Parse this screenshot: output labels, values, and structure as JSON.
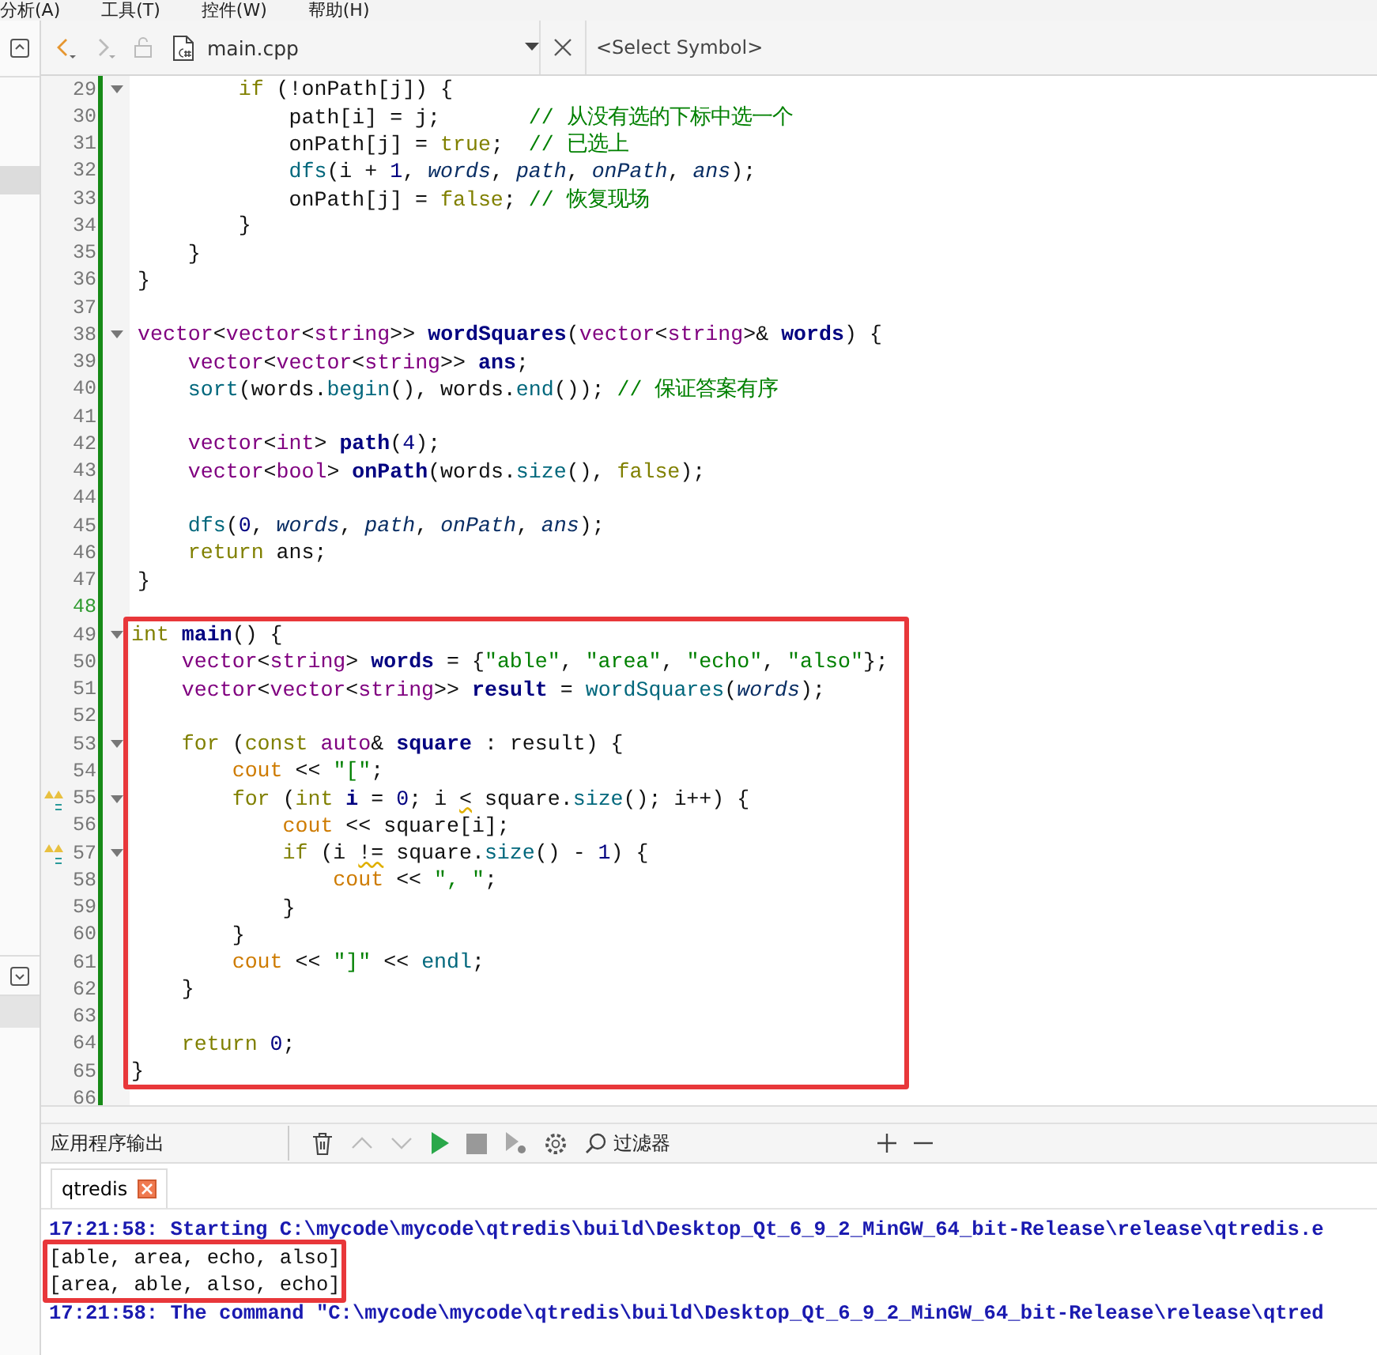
{
  "menu": [
    {
      "label": "分析(A)"
    },
    {
      "label": "工具(T)"
    },
    {
      "label": "控件(W)"
    },
    {
      "label": "帮助(H)"
    }
  ],
  "editor_toolbar": {
    "nav": [
      {
        "kind": "back",
        "disabled": false
      },
      {
        "kind": "forward",
        "disabled": true
      }
    ],
    "file": "main.cpp",
    "symbol": "<Select Symbol>"
  },
  "editor": {
    "blocks": [
      {
        "boxed": false,
        "lines": [
          {
            "number": "29",
            "fold": true,
            "warning": false,
            "current": false,
            "tokens": [
              {
                "kind": "keyword",
                "text": "        if"
              },
              {
                "kind": "plain",
                "text": " (!onPath[j]) {"
              }
            ]
          },
          {
            "number": "30",
            "fold": false,
            "warning": false,
            "current": false,
            "tokens": [
              {
                "kind": "plain",
                "text": "            path[i] = j;       "
              },
              {
                "kind": "comment",
                "text": "// 从没有选的下标中选一个"
              }
            ]
          },
          {
            "number": "31",
            "fold": false,
            "warning": false,
            "current": false,
            "tokens": [
              {
                "kind": "plain",
                "text": "            onPath[j] = "
              },
              {
                "kind": "keyword",
                "text": "true"
              },
              {
                "kind": "plain",
                "text": ";  "
              },
              {
                "kind": "comment",
                "text": "// 已选上"
              }
            ]
          },
          {
            "number": "32",
            "fold": false,
            "warning": false,
            "current": false,
            "tokens": [
              {
                "kind": "function",
                "text": "            dfs"
              },
              {
                "kind": "plain",
                "text": "(i + "
              },
              {
                "kind": "number",
                "text": "1"
              },
              {
                "kind": "plain",
                "text": ", "
              },
              {
                "kind": "param",
                "text": "words"
              },
              {
                "kind": "plain",
                "text": ", "
              },
              {
                "kind": "param",
                "text": "path"
              },
              {
                "kind": "plain",
                "text": ", "
              },
              {
                "kind": "param",
                "text": "onPath"
              },
              {
                "kind": "plain",
                "text": ", "
              },
              {
                "kind": "param",
                "text": "ans"
              },
              {
                "kind": "plain",
                "text": ");"
              }
            ]
          },
          {
            "number": "33",
            "fold": false,
            "warning": false,
            "current": false,
            "tokens": [
              {
                "kind": "plain",
                "text": "            onPath[j] = "
              },
              {
                "kind": "keyword",
                "text": "false"
              },
              {
                "kind": "plain",
                "text": "; "
              },
              {
                "kind": "comment",
                "text": "// 恢复现场"
              }
            ]
          },
          {
            "number": "34",
            "fold": false,
            "warning": false,
            "current": false,
            "tokens": [
              {
                "kind": "plain",
                "text": "        }"
              }
            ]
          },
          {
            "number": "35",
            "fold": false,
            "warning": false,
            "current": false,
            "tokens": [
              {
                "kind": "plain",
                "text": "    }"
              }
            ]
          },
          {
            "number": "36",
            "fold": false,
            "warning": false,
            "current": false,
            "tokens": [
              {
                "kind": "plain",
                "text": "}"
              }
            ]
          },
          {
            "number": "37",
            "fold": false,
            "warning": false,
            "current": false
          },
          {
            "number": "38",
            "fold": true,
            "warning": false,
            "current": false,
            "tokens": [
              {
                "kind": "type",
                "text": "vector"
              },
              {
                "kind": "plain",
                "text": "<"
              },
              {
                "kind": "type",
                "text": "vector"
              },
              {
                "kind": "plain",
                "text": "<"
              },
              {
                "kind": "type",
                "text": "string"
              },
              {
                "kind": "plain",
                "text": ">> "
              },
              {
                "kind": "decl",
                "text": "wordSquares"
              },
              {
                "kind": "plain",
                "text": "("
              },
              {
                "kind": "type",
                "text": "vector"
              },
              {
                "kind": "plain",
                "text": "<"
              },
              {
                "kind": "type",
                "text": "string"
              },
              {
                "kind": "plain",
                "text": ">& "
              },
              {
                "kind": "decl",
                "text": "words"
              },
              {
                "kind": "plain",
                "text": ") {"
              }
            ]
          },
          {
            "number": "39",
            "fold": false,
            "warning": false,
            "current": false,
            "tokens": [
              {
                "kind": "type",
                "text": "    vector"
              },
              {
                "kind": "plain",
                "text": "<"
              },
              {
                "kind": "type",
                "text": "vector"
              },
              {
                "kind": "plain",
                "text": "<"
              },
              {
                "kind": "type",
                "text": "string"
              },
              {
                "kind": "plain",
                "text": ">> "
              },
              {
                "kind": "decl",
                "text": "ans"
              },
              {
                "kind": "plain",
                "text": ";"
              }
            ]
          },
          {
            "number": "40",
            "fold": false,
            "warning": false,
            "current": false,
            "tokens": [
              {
                "kind": "function",
                "text": "    sort"
              },
              {
                "kind": "plain",
                "text": "(words."
              },
              {
                "kind": "function",
                "text": "begin"
              },
              {
                "kind": "plain",
                "text": "(), words."
              },
              {
                "kind": "function",
                "text": "end"
              },
              {
                "kind": "plain",
                "text": "()); "
              },
              {
                "kind": "comment",
                "text": "// 保证答案有序"
              }
            ]
          },
          {
            "number": "41",
            "fold": false,
            "warning": false,
            "current": false
          },
          {
            "number": "42",
            "fold": false,
            "warning": false,
            "current": false,
            "tokens": [
              {
                "kind": "type",
                "text": "    vector"
              },
              {
                "kind": "plain",
                "text": "<"
              },
              {
                "kind": "type",
                "text": "int"
              },
              {
                "kind": "plain",
                "text": "> "
              },
              {
                "kind": "decl",
                "text": "path"
              },
              {
                "kind": "plain",
                "text": "("
              },
              {
                "kind": "number",
                "text": "4"
              },
              {
                "kind": "plain",
                "text": ");"
              }
            ]
          },
          {
            "number": "43",
            "fold": false,
            "warning": false,
            "current": false,
            "tokens": [
              {
                "kind": "type",
                "text": "    vector"
              },
              {
                "kind": "plain",
                "text": "<"
              },
              {
                "kind": "type",
                "text": "bool"
              },
              {
                "kind": "plain",
                "text": "> "
              },
              {
                "kind": "decl",
                "text": "onPath"
              },
              {
                "kind": "plain",
                "text": "(words."
              },
              {
                "kind": "function",
                "text": "size"
              },
              {
                "kind": "plain",
                "text": "(), "
              },
              {
                "kind": "keyword",
                "text": "false"
              },
              {
                "kind": "plain",
                "text": ");"
              }
            ]
          },
          {
            "number": "44",
            "fold": false,
            "warning": false,
            "current": false
          },
          {
            "number": "45",
            "fold": false,
            "warning": false,
            "current": false,
            "tokens": [
              {
                "kind": "function",
                "text": "    dfs"
              },
              {
                "kind": "plain",
                "text": "("
              },
              {
                "kind": "number",
                "text": "0"
              },
              {
                "kind": "plain",
                "text": ", "
              },
              {
                "kind": "param",
                "text": "words"
              },
              {
                "kind": "plain",
                "text": ", "
              },
              {
                "kind": "param",
                "text": "path"
              },
              {
                "kind": "plain",
                "text": ", "
              },
              {
                "kind": "param",
                "text": "onPath"
              },
              {
                "kind": "plain",
                "text": ", "
              },
              {
                "kind": "param",
                "text": "ans"
              },
              {
                "kind": "plain",
                "text": ");"
              }
            ]
          },
          {
            "number": "46",
            "fold": false,
            "warning": false,
            "current": false,
            "tokens": [
              {
                "kind": "keyword",
                "text": "    return"
              },
              {
                "kind": "plain",
                "text": " ans;"
              }
            ]
          },
          {
            "number": "47",
            "fold": false,
            "warning": false,
            "current": false,
            "tokens": [
              {
                "kind": "plain",
                "text": "}"
              }
            ]
          },
          {
            "number": "48",
            "fold": false,
            "warning": false,
            "current": true
          }
        ]
      },
      {
        "boxed": true,
        "lines": [
          {
            "number": "49",
            "fold": true,
            "warning": false,
            "current": false,
            "tokens": [
              {
                "kind": "keyword",
                "text": "int"
              },
              {
                "kind": "decl",
                "text": " main"
              },
              {
                "kind": "plain",
                "text": "() {"
              }
            ]
          },
          {
            "number": "50",
            "fold": false,
            "warning": false,
            "current": false,
            "tokens": [
              {
                "kind": "type",
                "text": "    vector"
              },
              {
                "kind": "plain",
                "text": "<"
              },
              {
                "kind": "type",
                "text": "string"
              },
              {
                "kind": "plain",
                "text": "> "
              },
              {
                "kind": "decl",
                "text": "words"
              },
              {
                "kind": "plain",
                "text": " = {"
              },
              {
                "kind": "string",
                "text": "\"able\""
              },
              {
                "kind": "plain",
                "text": ", "
              },
              {
                "kind": "string",
                "text": "\"area\""
              },
              {
                "kind": "plain",
                "text": ", "
              },
              {
                "kind": "string",
                "text": "\"echo\""
              },
              {
                "kind": "plain",
                "text": ", "
              },
              {
                "kind": "string",
                "text": "\"also\""
              },
              {
                "kind": "plain",
                "text": "};"
              }
            ]
          },
          {
            "number": "51",
            "fold": false,
            "warning": false,
            "current": false,
            "tokens": [
              {
                "kind": "type",
                "text": "    vector"
              },
              {
                "kind": "plain",
                "text": "<"
              },
              {
                "kind": "type",
                "text": "vector"
              },
              {
                "kind": "plain",
                "text": "<"
              },
              {
                "kind": "type",
                "text": "string"
              },
              {
                "kind": "plain",
                "text": ">> "
              },
              {
                "kind": "decl",
                "text": "result"
              },
              {
                "kind": "plain",
                "text": " = "
              },
              {
                "kind": "function",
                "text": "wordSquares"
              },
              {
                "kind": "plain",
                "text": "("
              },
              {
                "kind": "param",
                "text": "words"
              },
              {
                "kind": "plain",
                "text": ");"
              }
            ]
          },
          {
            "number": "52",
            "fold": false,
            "warning": false,
            "current": false
          },
          {
            "number": "53",
            "fold": true,
            "warning": false,
            "current": false,
            "tokens": [
              {
                "kind": "keyword",
                "text": "    for"
              },
              {
                "kind": "plain",
                "text": " ("
              },
              {
                "kind": "keyword",
                "text": "const"
              },
              {
                "kind": "type",
                "text": " auto"
              },
              {
                "kind": "plain",
                "text": "& "
              },
              {
                "kind": "decl",
                "text": "square"
              },
              {
                "kind": "plain",
                "text": " : result) {"
              }
            ]
          },
          {
            "number": "54",
            "fold": false,
            "warning": false,
            "current": false,
            "tokens": [
              {
                "kind": "global",
                "text": "        cout"
              },
              {
                "kind": "plain",
                "text": " << "
              },
              {
                "kind": "string",
                "text": "\"[\""
              },
              {
                "kind": "plain",
                "text": ";"
              }
            ]
          },
          {
            "number": "55",
            "fold": true,
            "warning": true,
            "current": false,
            "tokens": [
              {
                "kind": "keyword",
                "text": "        for"
              },
              {
                "kind": "plain",
                "text": " ("
              },
              {
                "kind": "keyword",
                "text": "int"
              },
              {
                "kind": "decl",
                "text": " i"
              },
              {
                "kind": "plain",
                "text": " = "
              },
              {
                "kind": "number",
                "text": "0"
              },
              {
                "kind": "plain",
                "text": "; i "
              },
              {
                "kind": "warn",
                "text": "<"
              },
              {
                "kind": "plain",
                "text": " square."
              },
              {
                "kind": "function",
                "text": "size"
              },
              {
                "kind": "plain",
                "text": "(); i++) {"
              }
            ]
          },
          {
            "number": "56",
            "fold": false,
            "warning": false,
            "current": false,
            "tokens": [
              {
                "kind": "global",
                "text": "            cout"
              },
              {
                "kind": "plain",
                "text": " << square[i];"
              }
            ]
          },
          {
            "number": "57",
            "fold": true,
            "warning": true,
            "current": false,
            "tokens": [
              {
                "kind": "keyword",
                "text": "            if"
              },
              {
                "kind": "plain",
                "text": " (i "
              },
              {
                "kind": "warn",
                "text": "!="
              },
              {
                "kind": "plain",
                "text": " square."
              },
              {
                "kind": "function",
                "text": "size"
              },
              {
                "kind": "plain",
                "text": "() - "
              },
              {
                "kind": "number",
                "text": "1"
              },
              {
                "kind": "plain",
                "text": ") {"
              }
            ]
          },
          {
            "number": "58",
            "fold": false,
            "warning": false,
            "current": false,
            "tokens": [
              {
                "kind": "global",
                "text": "                cout"
              },
              {
                "kind": "plain",
                "text": " << "
              },
              {
                "kind": "string",
                "text": "\", \""
              },
              {
                "kind": "plain",
                "text": ";"
              }
            ]
          },
          {
            "number": "59",
            "fold": false,
            "warning": false,
            "current": false,
            "tokens": [
              {
                "kind": "plain",
                "text": "            }"
              }
            ]
          },
          {
            "number": "60",
            "fold": false,
            "warning": false,
            "current": false,
            "tokens": [
              {
                "kind": "plain",
                "text": "        }"
              }
            ]
          },
          {
            "number": "61",
            "fold": false,
            "warning": false,
            "current": false,
            "tokens": [
              {
                "kind": "global",
                "text": "        cout"
              },
              {
                "kind": "plain",
                "text": " << "
              },
              {
                "kind": "string",
                "text": "\"]\""
              },
              {
                "kind": "plain",
                "text": " << "
              },
              {
                "kind": "function",
                "text": "endl"
              },
              {
                "kind": "plain",
                "text": ";"
              }
            ]
          },
          {
            "number": "62",
            "fold": false,
            "warning": false,
            "current": false,
            "tokens": [
              {
                "kind": "plain",
                "text": "    }"
              }
            ]
          },
          {
            "number": "63",
            "fold": false,
            "warning": false,
            "current": false
          },
          {
            "number": "64",
            "fold": false,
            "warning": false,
            "current": false,
            "tokens": [
              {
                "kind": "keyword",
                "text": "    return"
              },
              {
                "kind": "number",
                "text": " 0"
              },
              {
                "kind": "plain",
                "text": ";"
              }
            ]
          },
          {
            "number": "65",
            "fold": false,
            "warning": false,
            "current": false,
            "tokens": [
              {
                "kind": "plain",
                "text": "}"
              }
            ]
          }
        ]
      },
      {
        "boxed": false,
        "lines": [
          {
            "number": "66",
            "fold": false,
            "warning": false,
            "current": false
          }
        ]
      }
    ]
  },
  "output": {
    "title": "应用程序输出",
    "filter": {
      "placeholder": "过滤器"
    },
    "tabs": [
      {
        "label": "qtredis",
        "selected": true
      }
    ],
    "blocks": [
      {
        "boxed": false,
        "lines": [
          {
            "kind": "system",
            "text": "17:21:58: Starting C:\\mycode\\mycode\\qtredis\\build\\Desktop_Qt_6_9_2_MinGW_64_bit-Release\\release\\qtredis.e"
          }
        ]
      },
      {
        "boxed": true,
        "lines": [
          {
            "kind": "program",
            "text": "[able, area, echo, also]"
          },
          {
            "kind": "program",
            "text": "[area, able, also, echo]"
          }
        ]
      },
      {
        "boxed": false,
        "lines": [
          {
            "kind": "system",
            "text": "17:21:58: The command \"C:\\mycode\\mycode\\qtredis\\build\\Desktop_Qt_6_9_2_MinGW_64_bit-Release\\release\\qtred"
          }
        ]
      }
    ]
  }
}
